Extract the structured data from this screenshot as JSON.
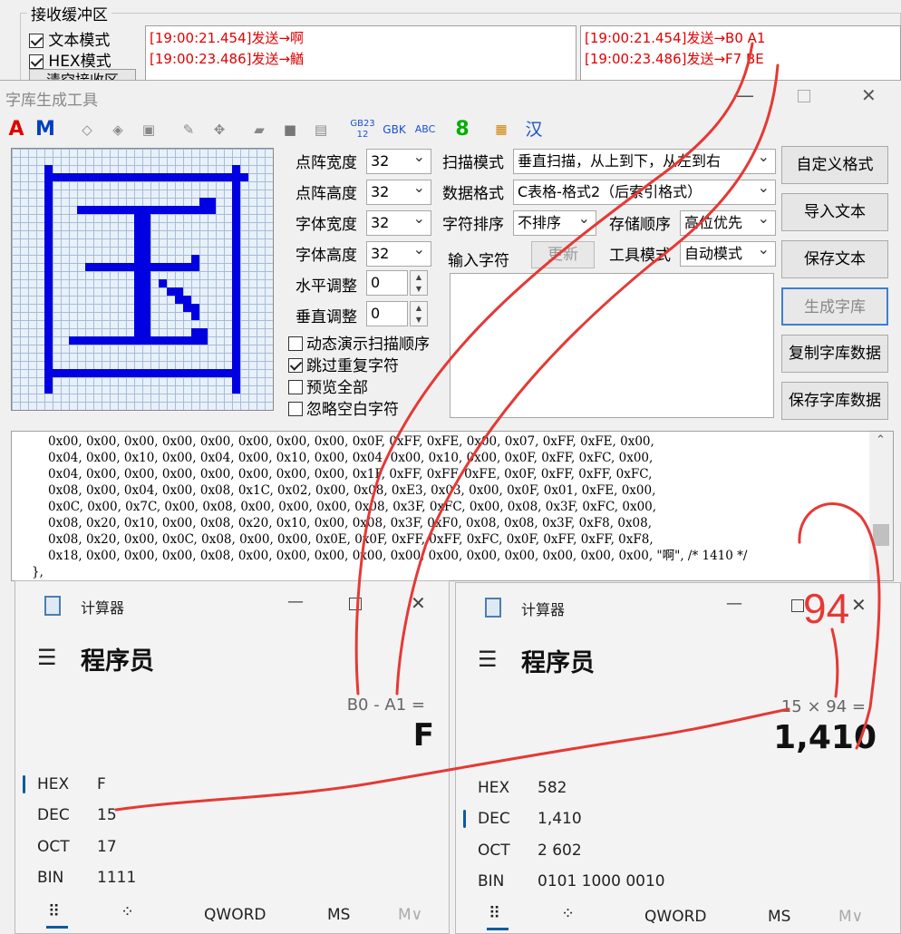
{
  "recv": {
    "group_title": "接收缓冲区",
    "text_mode_label": "文本模式",
    "hex_mode_label": "HEX模式",
    "clear_button": "清空接收区",
    "left_lines": [
      "[19:00:21.454]发送→啊",
      "[19:00:23.486]发送→鰌"
    ],
    "right_lines": [
      "[19:00:21.454]发送→B0 A1",
      "[19:00:23.486]发送→F7 BE"
    ]
  },
  "font_tool": {
    "title": "字库生成工具",
    "toolbar": [
      "A",
      "M",
      "GB2312",
      "GBK",
      "ABC",
      "8",
      "汉"
    ],
    "labels": {
      "dot_width": "点阵宽度",
      "dot_height": "点阵高度",
      "font_width": "字体宽度",
      "font_height": "字体高度",
      "h_adjust": "水平调整",
      "v_adjust": "垂直调整",
      "scan_mode": "扫描模式",
      "data_format": "数据格式",
      "char_order": "字符排序",
      "store_order": "存储顺序",
      "input_char": "输入字符",
      "tool_mode": "工具模式"
    },
    "values": {
      "dot_width": "32",
      "dot_height": "32",
      "font_width": "32",
      "font_height": "32",
      "h_adjust": "0",
      "v_adjust": "0",
      "scan_mode": "垂直扫描，从上到下，从左到右",
      "data_format": "C表格-格式2（后索引格式）",
      "char_order": "不排序",
      "store_order": "高位优先",
      "tool_mode": "自动模式"
    },
    "update_button": "更新",
    "checkboxes": [
      {
        "label": "动态演示扫描顺序",
        "checked": false
      },
      {
        "label": "跳过重复字符",
        "checked": true
      },
      {
        "label": "预览全部",
        "checked": false
      },
      {
        "label": "忽略空白字符",
        "checked": false
      }
    ],
    "right_buttons": [
      "自定义格式",
      "导入文本",
      "保存文本",
      "生成字库",
      "复制字库数据",
      "保存字库数据"
    ],
    "code_lines": [
      "0x00, 0x00, 0x00, 0x00, 0x00, 0x00, 0x00, 0x00, 0x0F, 0xFF, 0xFE, 0x00, 0x07, 0xFF, 0xFE, 0x00,",
      "0x04, 0x00, 0x10, 0x00, 0x04, 0x00, 0x10, 0x00, 0x04, 0x00, 0x10, 0x00, 0x0F, 0xFF, 0xFC, 0x00,",
      "0x04, 0x00, 0x00, 0x00, 0x00, 0x00, 0x00, 0x00, 0x1F, 0xFF, 0xFF, 0xFE, 0x0F, 0xFF, 0xFF, 0xFC,",
      "0x08, 0x00, 0x04, 0x00, 0x08, 0x1C, 0x02, 0x00, 0x08, 0xE3, 0x03, 0x00, 0x0F, 0x01, 0xFE, 0x00,",
      "0x0C, 0x00, 0x7C, 0x00, 0x08, 0x00, 0x00, 0x00, 0x08, 0x3F, 0xFC, 0x00, 0x08, 0x3F, 0xFC, 0x00,",
      "0x08, 0x20, 0x10, 0x00, 0x08, 0x20, 0x10, 0x00, 0x08, 0x3F, 0xF0, 0x08, 0x08, 0x3F, 0xF8, 0x08,",
      "0x08, 0x20, 0x00, 0x0C, 0x08, 0x00, 0x00, 0x0E, 0x0F, 0xFF, 0xFF, 0xFC, 0x0F, 0xFF, 0xFF, 0xF8,",
      "0x18, 0x00, 0x00, 0x00, 0x08, 0x00, 0x00, 0x00, 0x00, 0x00, 0x00, 0x00, 0x00, 0x00, 0x00, 0x00, \"啊\", /* 1410 */",
      "},"
    ]
  },
  "calc_left": {
    "title": "计算器",
    "mode": "程序员",
    "expression": "B0 - A1 =",
    "result": "F",
    "rows": [
      {
        "label": "HEX",
        "value": "F"
      },
      {
        "label": "DEC",
        "value": "15"
      },
      {
        "label": "OCT",
        "value": "17"
      },
      {
        "label": "BIN",
        "value": "1111"
      }
    ],
    "word": "QWORD",
    "ms": "MS",
    "mv": "M∨"
  },
  "calc_right": {
    "title": "计算器",
    "mode": "程序员",
    "expression": "15 × 94 =",
    "result": "1,410",
    "rows": [
      {
        "label": "HEX",
        "value": "582"
      },
      {
        "label": "DEC",
        "value": "1,410"
      },
      {
        "label": "OCT",
        "value": "2 602"
      },
      {
        "label": "BIN",
        "value": "0101 1000 0010"
      }
    ],
    "word": "QWORD",
    "ms": "MS",
    "mv": "M∨"
  },
  "annotation": {
    "text": "94",
    "color": "#e53935"
  }
}
